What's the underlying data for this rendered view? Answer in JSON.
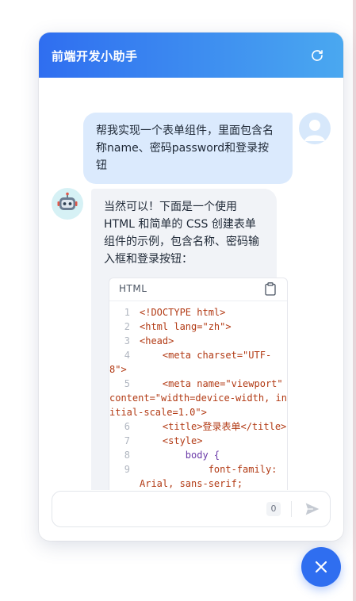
{
  "header": {
    "title": "前端开发小助手",
    "refresh_icon": "refresh-icon"
  },
  "messages": {
    "user_text": "帮我实现一个表单组件，里面包含名称name、密码password和登录按钮",
    "bot_intro": "当然可以！下面是一个使用 HTML 和简单的 CSS 创建表单组件的示例，包含名称、密码输入框和登录按钮：",
    "code": {
      "language": "HTML",
      "copy_icon": "clipboard-icon",
      "lines": [
        {
          "n": "1",
          "text": "<!DOCTYPE html>"
        },
        {
          "n": "2",
          "text": "<html lang=\"zh\">"
        },
        {
          "n": "3",
          "text": "<head>"
        },
        {
          "n": "4",
          "text": "    <meta charset=\"UTF-8\">"
        },
        {
          "n": "5",
          "text": "    <meta name=\"viewport\" content=\"width=device-width, initial-scale=1.0\">"
        },
        {
          "n": "6",
          "text": "    <title>登录表单</title>"
        },
        {
          "n": "7",
          "text": "    <style>"
        },
        {
          "n": "8",
          "text": "        body {"
        },
        {
          "n": "9",
          "text": "            font-family: Arial, sans-serif;"
        }
      ]
    }
  },
  "input": {
    "placeholder": "",
    "char_count": "0",
    "send_icon": "send-icon"
  },
  "fab": {
    "icon": "close-icon"
  },
  "colors": {
    "header_start": "#2f6ef0",
    "header_end": "#4aa8f0",
    "user_bubble": "#dbeafd",
    "bot_bubble": "#f1f3f7",
    "fab": "#2f6ef0"
  }
}
